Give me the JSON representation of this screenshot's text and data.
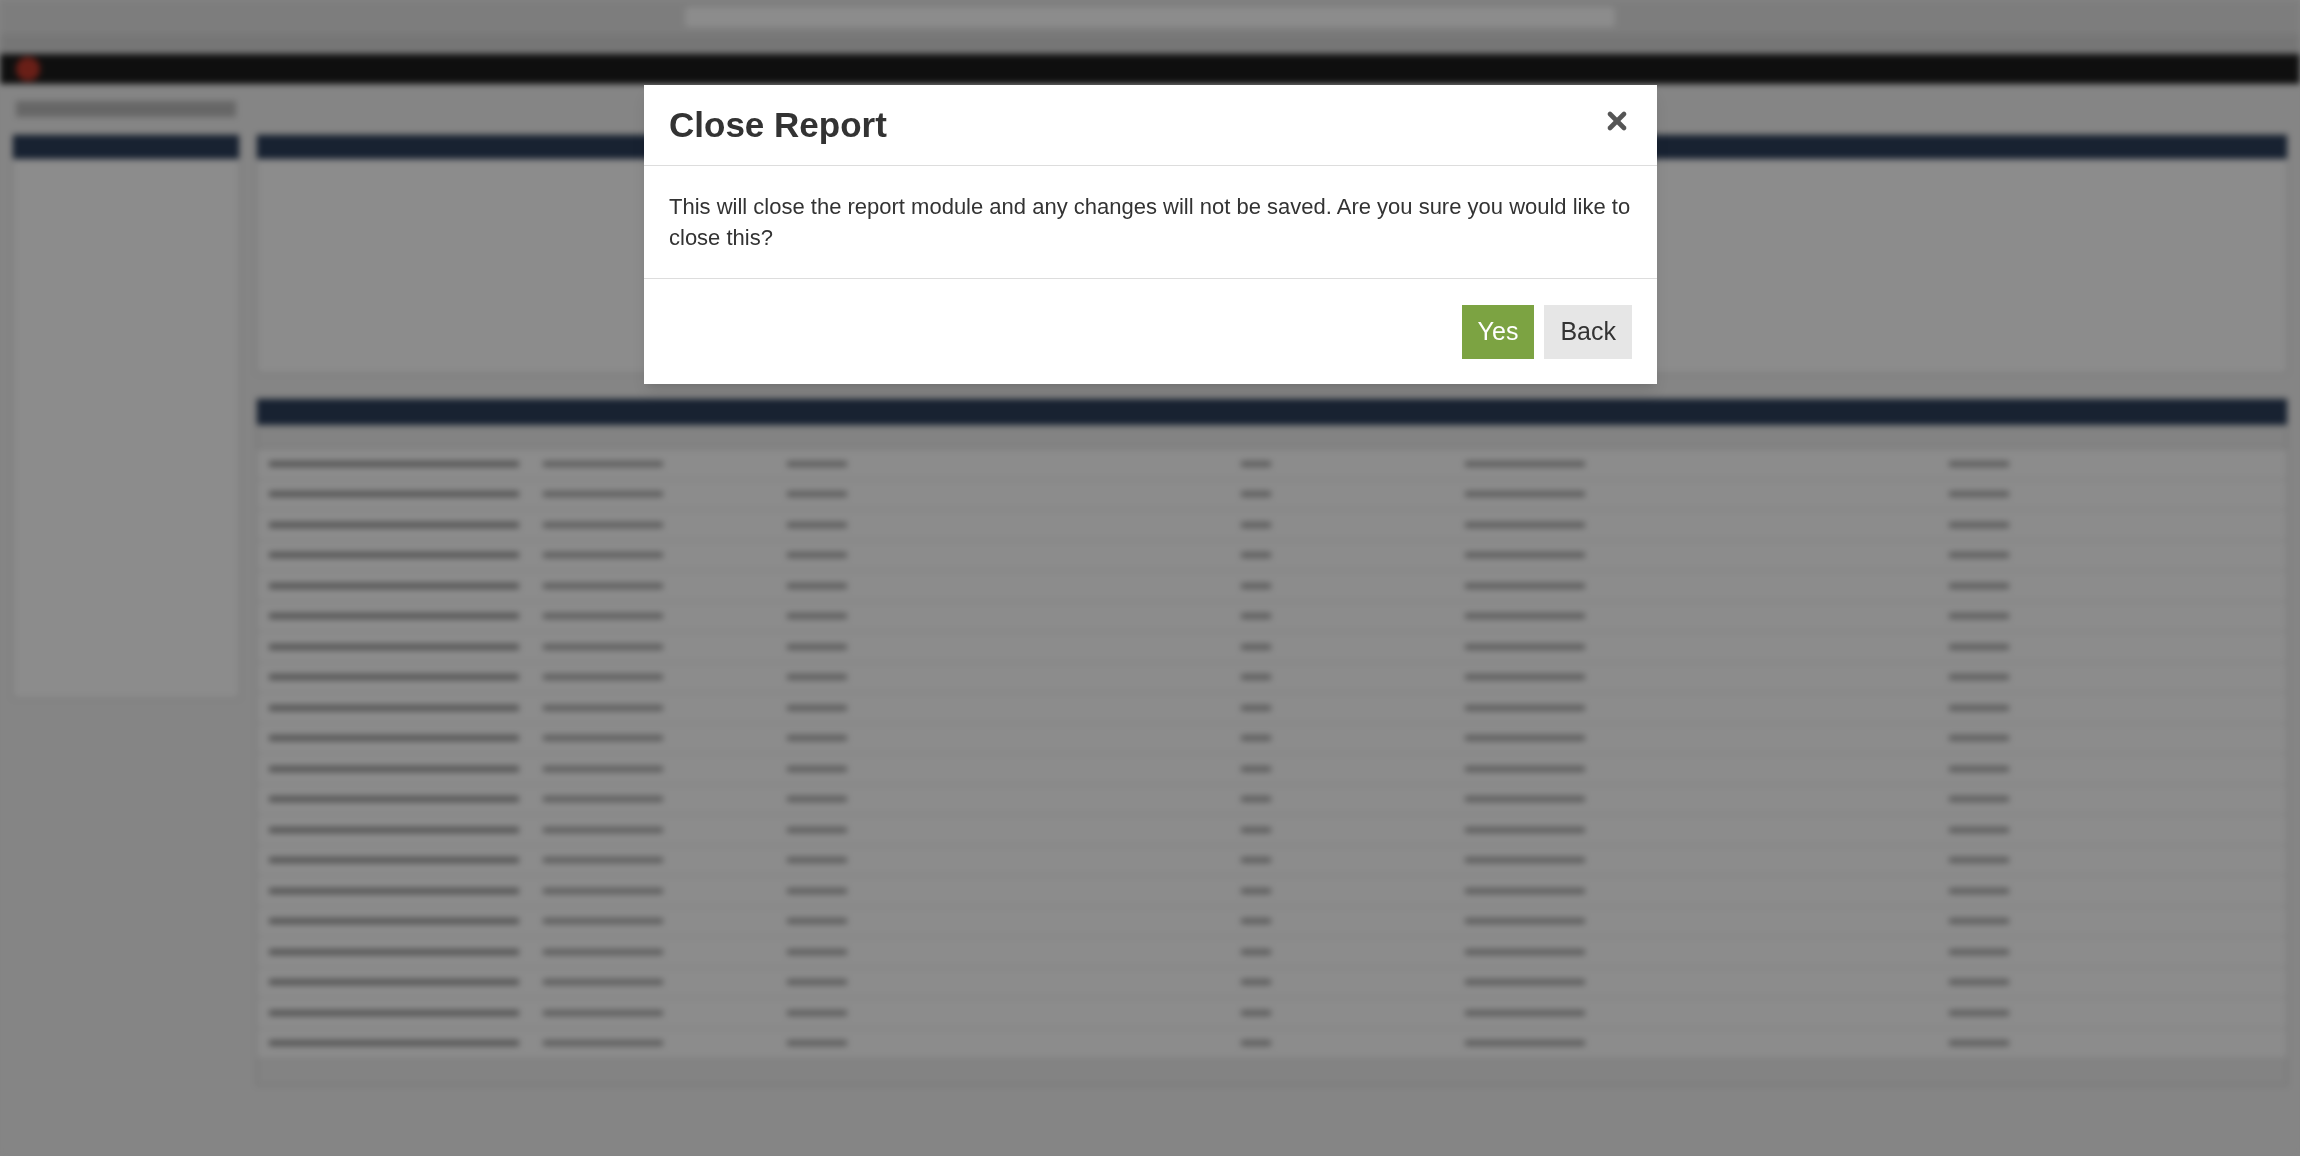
{
  "dialog": {
    "title": "Close Report",
    "message": "This will close the report module and any changes will not be saved. Are you sure you would like to close this?",
    "buttons": [
      {
        "label": "Yes",
        "kind": "primary"
      },
      {
        "label": "Back",
        "kind": "secondary"
      }
    ]
  }
}
